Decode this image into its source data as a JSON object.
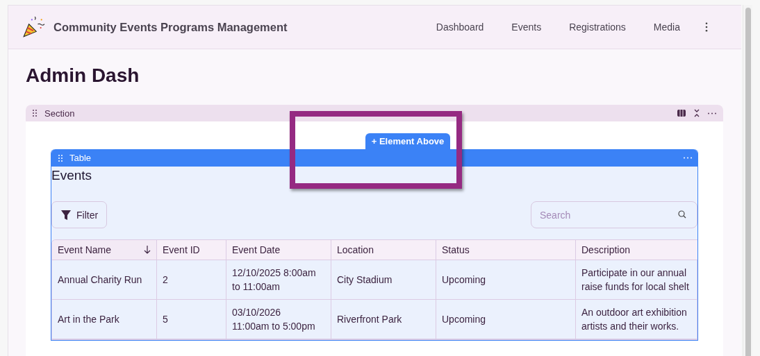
{
  "app": {
    "title": "Community Events Programs Management"
  },
  "nav": {
    "items": [
      {
        "label": "Dashboard"
      },
      {
        "label": "Events"
      },
      {
        "label": "Registrations"
      },
      {
        "label": "Media"
      }
    ]
  },
  "page": {
    "title": "Admin Dash"
  },
  "section": {
    "label": "Section"
  },
  "add_element": {
    "label": "+ Element Above"
  },
  "table_block": {
    "label": "Table",
    "title": "Events",
    "filter": "Filter",
    "search": {
      "placeholder": "Search"
    },
    "columns": [
      {
        "label": "Event Name",
        "sorted": true
      },
      {
        "label": "Event ID",
        "sorted": false
      },
      {
        "label": "Event Date",
        "sorted": false
      },
      {
        "label": "Location",
        "sorted": false
      },
      {
        "label": "Status",
        "sorted": false
      },
      {
        "label": "Description",
        "sorted": false
      }
    ],
    "rows": [
      [
        "Annual Charity Run",
        "2",
        "12/10/2025 8:00am\nto 11:00am",
        "City Stadium",
        "Upcoming",
        "Participate in our annual\nraise funds for local shelt"
      ],
      [
        "Art in the Park",
        "5",
        "03/10/2026\n11:00am to 5:00pm",
        "Riverfront Park",
        "Upcoming",
        "An outdoor art exhibition\nartists and their works."
      ]
    ]
  }
}
